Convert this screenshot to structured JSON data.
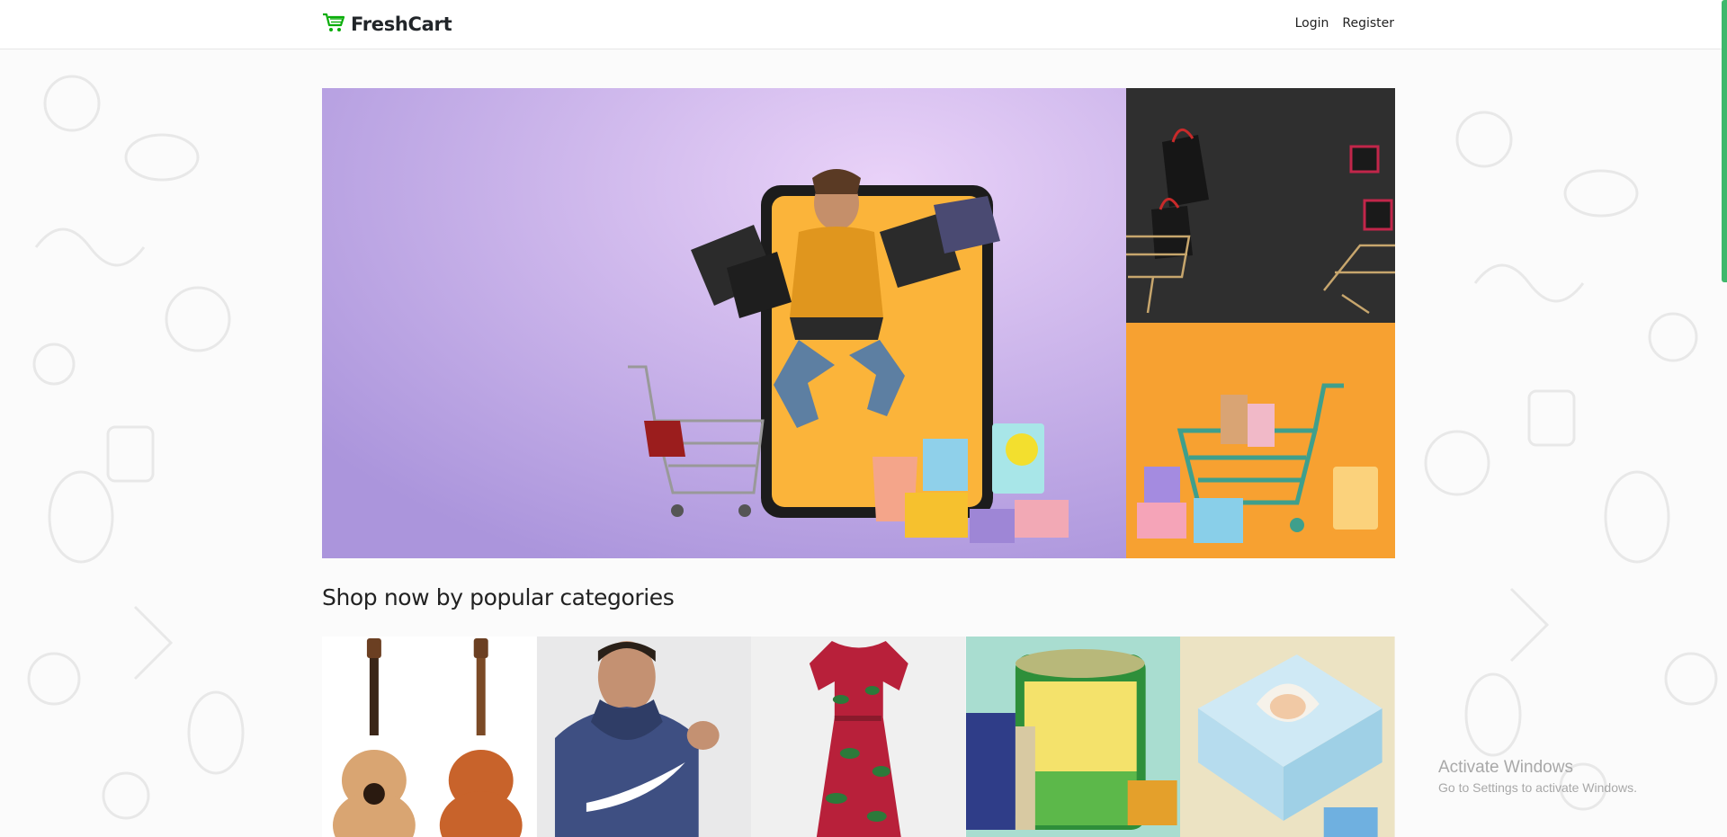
{
  "brand": {
    "name": "FreshCart",
    "icon": "cart-icon"
  },
  "nav": {
    "login_label": "Login",
    "register_label": "Register"
  },
  "hero": {
    "main_slide": "shopping-jump-banner",
    "side_top": "black-bags-carts-banner",
    "side_bottom": "orange-cart-gifts-banner"
  },
  "categories_section": {
    "title": "Shop now by popular categories",
    "items": [
      {
        "icon": "guitar-image"
      },
      {
        "icon": "hoodie-image"
      },
      {
        "icon": "dress-image"
      },
      {
        "icon": "grocery-image"
      },
      {
        "icon": "diapers-image"
      }
    ]
  },
  "watermark": {
    "title": "Activate Windows",
    "subtitle": "Go to Settings to activate Windows."
  },
  "colors": {
    "accent": "#0aad0a",
    "scrollbar": "#3fb86c",
    "text": "#212529"
  }
}
